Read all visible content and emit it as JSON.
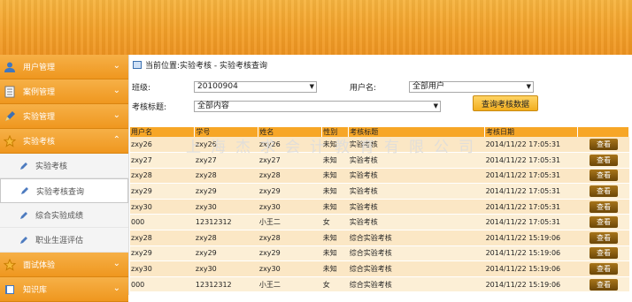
{
  "sidebar": {
    "items": [
      {
        "label": "用户管理",
        "icon": "user-icon"
      },
      {
        "label": "案例管理",
        "icon": "document-icon"
      },
      {
        "label": "实验管理",
        "icon": "pencil-icon"
      },
      {
        "label": "实验考核",
        "icon": "star-icon"
      }
    ],
    "subitems": [
      {
        "label": "实验考核"
      },
      {
        "label": "实验考核查询"
      },
      {
        "label": "综合实验成绩"
      },
      {
        "label": "职业生涯评估"
      }
    ],
    "bottom_items": [
      {
        "label": "面试体验",
        "icon": "star-icon"
      },
      {
        "label": "知识库",
        "icon": "book-icon"
      }
    ]
  },
  "breadcrumb": "当前位置:实验考核 - 实验考核查询",
  "filters": {
    "class_label": "班级:",
    "class_value": "20100904",
    "user_label": "用户名:",
    "user_value": "全部用户",
    "title_label": "考核标题:",
    "title_value": "全部内容",
    "query_button": "查询考核数据"
  },
  "table": {
    "headers": [
      "用户名",
      "学号",
      "姓名",
      "性别",
      "考核标题",
      "考核日期",
      ""
    ],
    "rows": [
      [
        "zxy26",
        "zxy26",
        "zxy26",
        "未知",
        "实验考核",
        "2014/11/22 17:05:31"
      ],
      [
        "zxy27",
        "zxy27",
        "zxy27",
        "未知",
        "实验考核",
        "2014/11/22 17:05:31"
      ],
      [
        "zxy28",
        "zxy28",
        "zxy28",
        "未知",
        "实验考核",
        "2014/11/22 17:05:31"
      ],
      [
        "zxy29",
        "zxy29",
        "zxy29",
        "未知",
        "实验考核",
        "2014/11/22 17:05:31"
      ],
      [
        "zxy30",
        "zxy30",
        "zxy30",
        "未知",
        "实验考核",
        "2014/11/22 17:05:31"
      ],
      [
        "000",
        "12312312",
        "小王二",
        "女",
        "实验考核",
        "2014/11/22 17:05:31"
      ],
      [
        "zxy28",
        "zxy28",
        "zxy28",
        "未知",
        "综合实验考核",
        "2014/11/22 15:19:06"
      ],
      [
        "zxy29",
        "zxy29",
        "zxy29",
        "未知",
        "综合实验考核",
        "2014/11/22 15:19:06"
      ],
      [
        "zxy30",
        "zxy30",
        "zxy30",
        "未知",
        "综合实验考核",
        "2014/11/22 15:19:06"
      ],
      [
        "000",
        "12312312",
        "小王二",
        "女",
        "综合实验考核",
        "2014/11/22 15:19:06"
      ]
    ],
    "action_label": "查看"
  },
  "watermark": "上海杰求会计教育有限公司",
  "colors": {
    "accent": "#f7a626",
    "button_dark": "#7a5210"
  }
}
